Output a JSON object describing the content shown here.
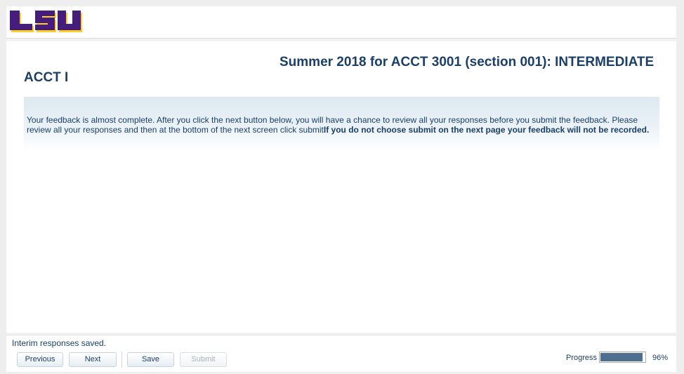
{
  "header": {
    "logo_text": "LSU",
    "brand_colors": {
      "purple": "#461d7c",
      "gold": "#fdd023"
    }
  },
  "main": {
    "title_line1": "Summer 2018 for ACCT 3001 (section 001): INTERMEDIATE",
    "title_line2": "ACCT I",
    "notice": {
      "text_plain": "Your feedback is almost complete. After you click the next button below, you will have a chance to review all your responses before you submit the feedback. Please review all your responses and then at the bottom of the next screen click submit",
      "text_bold": "If you do not choose submit on the next page your feedback will not be recorded."
    }
  },
  "footer": {
    "status": "Interim responses saved.",
    "buttons": {
      "previous": "Previous",
      "next": "Next",
      "save": "Save",
      "submit": "Submit"
    },
    "progress": {
      "label": "Progress",
      "percent_text": "96%",
      "value": 0.96
    }
  },
  "colors": {
    "accent_text": "#1b3f67",
    "progress_fill": "#4e6f90"
  }
}
